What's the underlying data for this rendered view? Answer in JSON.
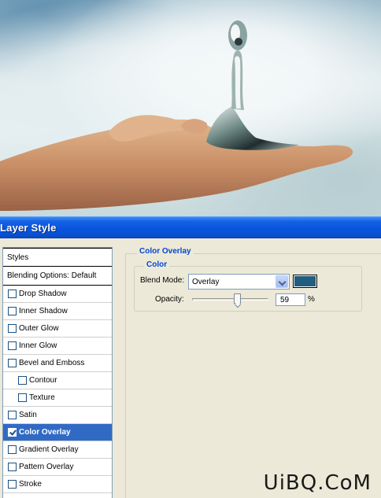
{
  "window": {
    "title": "Layer Style"
  },
  "sidebar": {
    "header": "Styles",
    "blending_options": "Blending Options: Default",
    "items": [
      {
        "label": "Drop Shadow",
        "checked": false,
        "sub": false
      },
      {
        "label": "Inner Shadow",
        "checked": false,
        "sub": false
      },
      {
        "label": "Outer Glow",
        "checked": false,
        "sub": false
      },
      {
        "label": "Inner Glow",
        "checked": false,
        "sub": false
      },
      {
        "label": "Bevel and Emboss",
        "checked": false,
        "sub": false
      },
      {
        "label": "Contour",
        "checked": false,
        "sub": true
      },
      {
        "label": "Texture",
        "checked": false,
        "sub": true
      },
      {
        "label": "Satin",
        "checked": false,
        "sub": false
      },
      {
        "label": "Color Overlay",
        "checked": true,
        "sub": false,
        "selected": true
      },
      {
        "label": "Gradient Overlay",
        "checked": false,
        "sub": false
      },
      {
        "label": "Pattern Overlay",
        "checked": false,
        "sub": false
      },
      {
        "label": "Stroke",
        "checked": false,
        "sub": false
      }
    ]
  },
  "panel": {
    "group_title": "Color Overlay",
    "subgroup_title": "Color",
    "blend_mode_label": "Blend Mode:",
    "blend_mode_value": "Overlay",
    "overlay_color": "#205d7e",
    "opacity_label": "Opacity:",
    "opacity_value": "59",
    "opacity_unit": "%",
    "opacity_fraction": 0.59
  },
  "watermark": "UiBQ.CoM"
}
